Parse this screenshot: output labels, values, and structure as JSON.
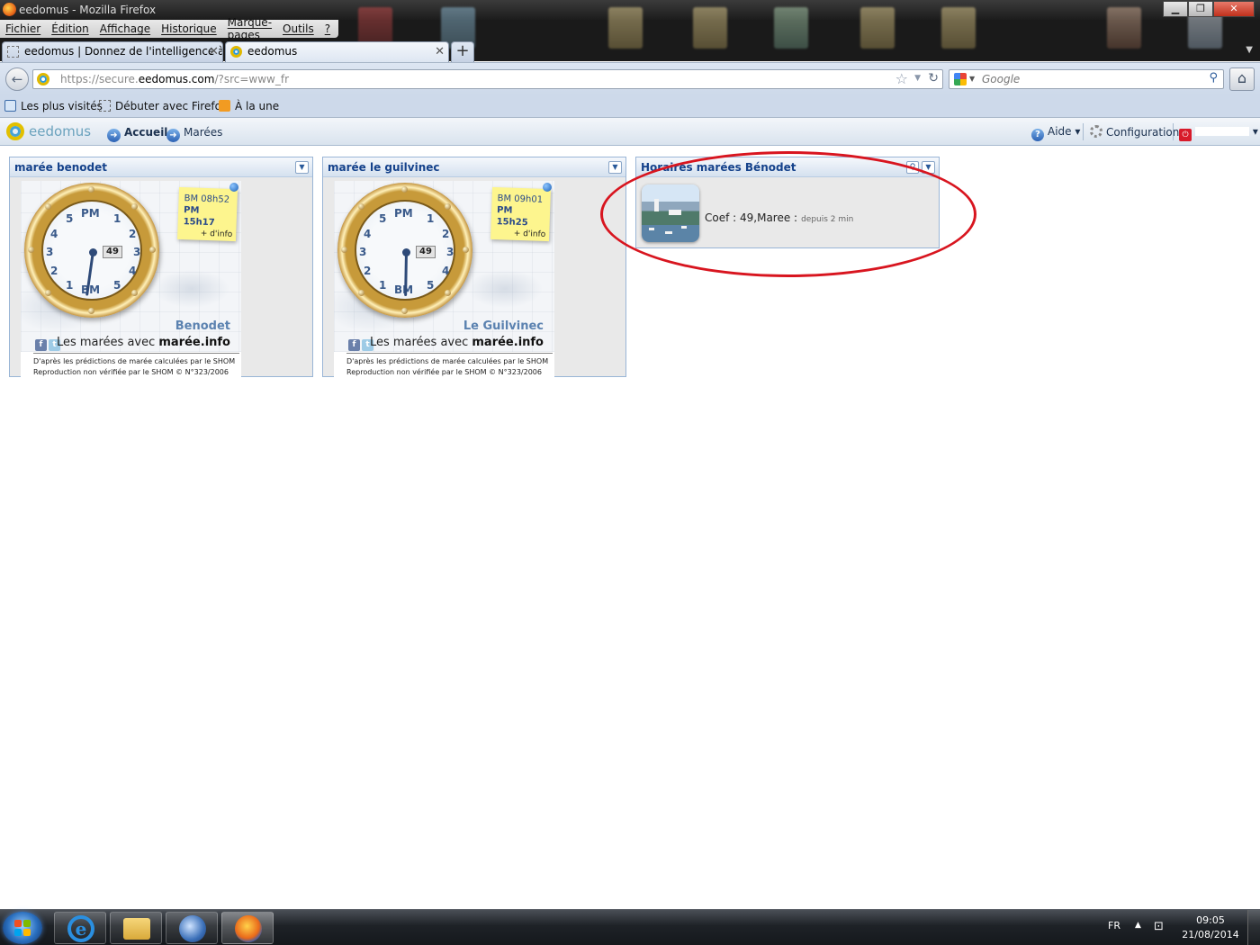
{
  "window": {
    "title": "eedomus - Mozilla Firefox"
  },
  "menubar": {
    "items": [
      "Fichier",
      "Édition",
      "Affichage",
      "Historique",
      "Marque-pages",
      "Outils",
      "?"
    ]
  },
  "tabs": [
    {
      "label": "eedomus | Donnez de l'intelligence à ...",
      "active": false
    },
    {
      "label": "eedomus",
      "active": true
    }
  ],
  "navbar": {
    "url_prefix": "https://secure.",
    "url_domain": "eedomus.com",
    "url_suffix": "/?src=www_fr",
    "search_placeholder": "Google"
  },
  "bookmarks": {
    "items": [
      "Les plus visités",
      "Débuter avec Firefox",
      "À la une"
    ]
  },
  "app": {
    "logo_text": "eedomus",
    "nav": [
      "Accueil",
      "Marées"
    ],
    "help_label": "Aide",
    "config_label": "Configuration"
  },
  "widgets": [
    {
      "title": "marée benodet",
      "bm": "BM 08h52",
      "pm": "PM 15h17",
      "info": "+ d'info",
      "coef": "49",
      "place": "Benodet",
      "slogan_prefix": "Les marées avec ",
      "slogan_brand": "marée.info",
      "credit_line1": "D'après les prédictions de marée calculées par le SHOM",
      "credit_line2": "Reproduction non vérifiée par le SHOM © N°323/2006",
      "dial_pm": "PM",
      "dial_bm": "BM"
    },
    {
      "title": "marée le guilvinec",
      "bm": "BM 09h01",
      "pm": "PM 15h25",
      "info": "+ d'info",
      "coef": "49",
      "place": "Le Guilvinec",
      "slogan_prefix": "Les marées avec ",
      "slogan_brand": "marée.info",
      "credit_line1": "D'après les prédictions de marée calculées par le SHOM",
      "credit_line2": "Reproduction non vérifiée par le SHOM © N°323/2006",
      "dial_pm": "PM",
      "dial_bm": "BM"
    }
  ],
  "horaires": {
    "title": "Horaires marées Bénodet",
    "text": "Coef : 49,Maree :",
    "since": "depuis 2 min"
  },
  "taskbar": {
    "lang": "FR",
    "time": "09:05",
    "date": "21/08/2014"
  },
  "colors": {
    "accent": "#15428b",
    "highlight_ellipse": "#d8151f",
    "note_yellow": "#fdf58e"
  }
}
